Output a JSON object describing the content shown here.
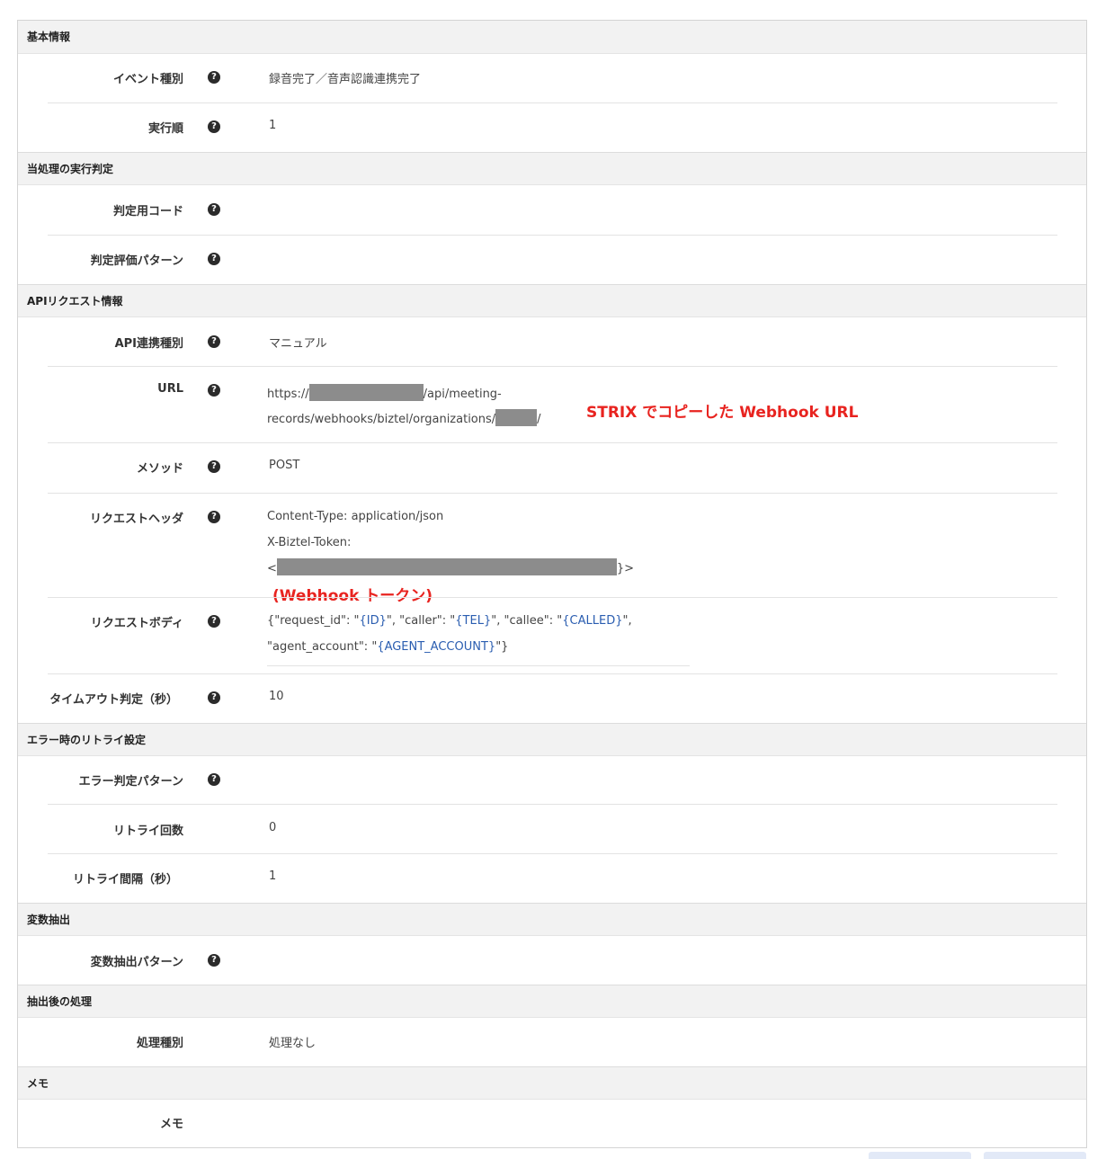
{
  "sections": {
    "basic": {
      "title": "基本情報",
      "event_type": {
        "label": "イベント種別",
        "value": "録音完了／音声認識連携完了"
      },
      "exec_order": {
        "label": "実行順",
        "value": "1"
      }
    },
    "judge": {
      "title": "当処理の実行判定",
      "code": {
        "label": "判定用コード"
      },
      "pattern": {
        "label": "判定評価パターン"
      }
    },
    "api": {
      "title": "APIリクエスト情報",
      "type": {
        "label": "API連携種別",
        "value": "マニュアル"
      },
      "url": {
        "label": "URL",
        "line1_pre": "https://",
        "line1_post": "/api/meeting-",
        "line2_pre": "records/webhooks/biztel/organizations/",
        "line2_post": "/"
      },
      "method": {
        "label": "メソッド",
        "value": "POST"
      },
      "headers": {
        "label": "リクエストヘッダ",
        "line1": "Content-Type: application/json",
        "line2": "X-Biztel-Token:",
        "line3_pre": "<",
        "line3_post": "}>"
      },
      "body": {
        "label": "リクエストボディ",
        "p1": "{\"request_id\": \"",
        "v1": "{ID}",
        "p2": "\", \"caller\": \"",
        "v2": "{TEL}",
        "p3": "\", \"callee\": \"",
        "v3": "{CALLED}",
        "p4": "\",",
        "p5": "\"agent_account\": \"",
        "v4": "{AGENT_ACCOUNT}",
        "p6": "\"}"
      },
      "timeout": {
        "label": "タイムアウト判定（秒）",
        "value": "10"
      }
    },
    "retry": {
      "title": "エラー時のリトライ設定",
      "pattern": {
        "label": "エラー判定パターン"
      },
      "count": {
        "label": "リトライ回数",
        "value": "0"
      },
      "interval": {
        "label": "リトライ間隔（秒）",
        "value": "1"
      }
    },
    "extract": {
      "title": "変数抽出",
      "pattern": {
        "label": "変数抽出パターン"
      }
    },
    "after": {
      "title": "抽出後の処理",
      "type": {
        "label": "処理種別",
        "value": "処理なし"
      }
    },
    "memo": {
      "title": "メモ",
      "memo": {
        "label": "メモ"
      }
    }
  },
  "annotations": {
    "webhook_url": "STRIX でコピーした Webhook URL",
    "webhook_token": "(Webhook トークン)"
  },
  "icons": {
    "help": "question-circle-icon"
  }
}
